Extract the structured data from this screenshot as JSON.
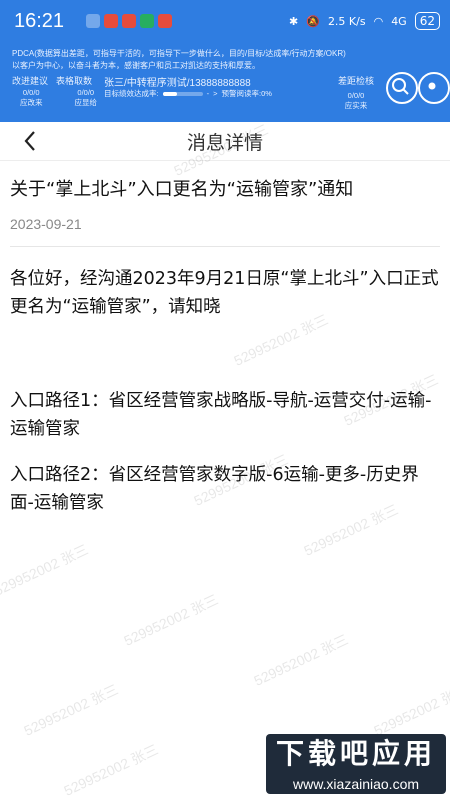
{
  "status_bar": {
    "time": "16:21",
    "network_speed": "2.5 K/s",
    "network_type": "4G",
    "battery": "62"
  },
  "banner": {
    "line1": "PDCA(数据算出差距，可指导干活的，可指导下一步做什么，目的/目标/达成率/行动方案/OKR)",
    "line2": "以客户为中心，以奋斗者为本，感谢客户和员工对凯达的支持和厚爱。",
    "metrics": [
      {
        "label": "改进建议",
        "value": "0/0/0",
        "sub": "应改来"
      },
      {
        "label": "表格取数",
        "value": "0/0/0",
        "sub": "应显给"
      }
    ],
    "user_info": "张三/中转程序测试/13888888888",
    "progress_label": "目标绩效达成率:",
    "progress_value": "-",
    "progress_fraction": 0.35,
    "warning_label": "预警阅读率:0%",
    "right_metric": {
      "label": "差距检核",
      "value": "0/0/0",
      "sub": "应实来"
    }
  },
  "header": {
    "title": "消息详情"
  },
  "message": {
    "title": "关于“掌上北斗”入口更名为“运输管家”通知",
    "date": "2023-09-21",
    "paragraph1": "各位好，经沟通2023年9月21日原“掌上北斗”入口正式更名为“运输管家”，请知晓",
    "paragraph2": "入口路径1：省区经营管家战略版-导航-运营交付-运输-运输管家",
    "paragraph3": "入口路径2：省区经营管家数字版-6运输-更多-历史界面-运输管家"
  },
  "watermark_text": "529952002 张三",
  "logo": {
    "main": "下载吧应用",
    "sub": "www.xiazainiao.com"
  }
}
